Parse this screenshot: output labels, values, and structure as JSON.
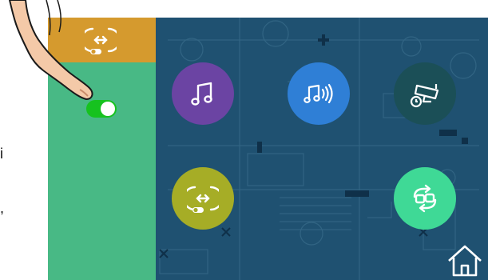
{
  "colors": {
    "background": "#1f5171",
    "sidebar": "#48b985",
    "sidebar_header": "#d59a2e",
    "toggle_on": "#16c21f"
  },
  "sidebar": {
    "header_icon": "door-transfer-icon",
    "toggle": {
      "state": "on"
    }
  },
  "buttons": [
    {
      "icon": "music-note-icon",
      "color": "#6b44a3"
    },
    {
      "icon": "music-volume-icon",
      "color": "#2f7fd6"
    },
    {
      "icon": "cctv-camera-timer-icon",
      "color": "#1b4f57"
    },
    {
      "icon": "door-transfer-icon",
      "color": "#a6ad26"
    },
    {
      "icon": "swap-hands-icon",
      "color": "#3fd996"
    }
  ],
  "nav": {
    "home_icon": "home-icon"
  },
  "edge_text": {
    "char_1": "i",
    "char_2": ","
  }
}
